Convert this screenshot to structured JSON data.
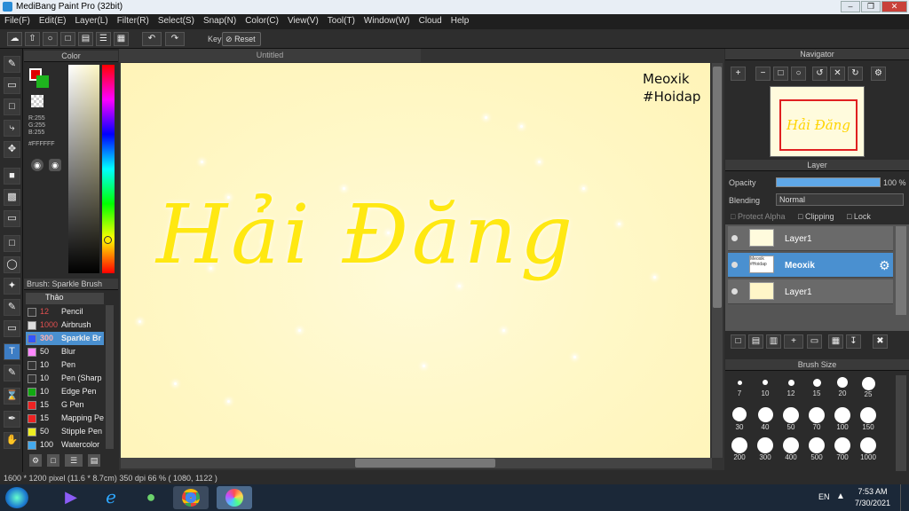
{
  "window": {
    "title": "MediBang Paint Pro (32bit)"
  },
  "menu": [
    "File(F)",
    "Edit(E)",
    "Layer(L)",
    "Filter(R)",
    "Select(S)",
    "Snap(N)",
    "Color(C)",
    "View(V)",
    "Tool(T)",
    "Window(W)",
    "Cloud",
    "Help"
  ],
  "toolbar": {
    "key_label": "Key",
    "reset_label": "Reset"
  },
  "color_panel": {
    "title": "Color",
    "r": "R:255",
    "g": "G:255",
    "b": "B:255",
    "hex": "#FFFFFF",
    "fg_color": "#e00000",
    "bg_color": "#1eb41e"
  },
  "brush_panel": {
    "title": "Brush: Sparkle Brush",
    "group": "Thảo",
    "brushes": [
      {
        "size": "12",
        "name": "Pencil",
        "color": "#333333",
        "size_color": "#e05050"
      },
      {
        "size": "1000",
        "name": "Airbrush",
        "color": "#dddddd",
        "size_color": "#e05050"
      },
      {
        "size": "300",
        "name": "Sparkle Br",
        "color": "#3355ff",
        "size_color": "#ff8080"
      },
      {
        "size": "50",
        "name": "Blur",
        "color": "#ff88ff",
        "size_color": "#eeeeee"
      },
      {
        "size": "10",
        "name": "Pen",
        "color": "#333333",
        "size_color": "#eeeeee"
      },
      {
        "size": "10",
        "name": "Pen (Sharp",
        "color": "#333333",
        "size_color": "#eeeeee"
      },
      {
        "size": "10",
        "name": "Edge Pen",
        "color": "#11aa11",
        "size_color": "#eeeeee"
      },
      {
        "size": "15",
        "name": "G Pen",
        "color": "#ee2222",
        "size_color": "#eeeeee"
      },
      {
        "size": "15",
        "name": "Mapping Pe",
        "color": "#ee2222",
        "size_color": "#eeeeee"
      },
      {
        "size": "50",
        "name": "Stipple Pen",
        "color": "#eeee22",
        "size_color": "#eeeeee"
      },
      {
        "size": "100",
        "name": "Watercolor",
        "color": "#44aaee",
        "size_color": "#eeeeee"
      }
    ]
  },
  "canvas": {
    "tab_title": "Untitled",
    "watermark_line1": "Meoxik",
    "watermark_line2": "#Hoidap",
    "artwork_text": "Hải Đăng",
    "artwork_color": "#ffe812"
  },
  "navigator": {
    "title": "Navigator"
  },
  "layer_panel": {
    "title": "Layer",
    "opacity_label": "Opacity",
    "opacity_value": "100 %",
    "blending_label": "Blending",
    "blending_value": "Normal",
    "protect_alpha": "Protect Alpha",
    "clipping": "Clipping",
    "lock": "Lock",
    "layers": [
      {
        "name": "Layer1",
        "selected": false
      },
      {
        "name": "Meoxik",
        "selected": true,
        "thumb_text": "Meoxik #Hoidap"
      },
      {
        "name": "Layer1",
        "selected": false
      }
    ]
  },
  "brush_size": {
    "title": "Brush Size",
    "sizes": [
      "7",
      "10",
      "12",
      "15",
      "20",
      "25",
      "30",
      "40",
      "50",
      "70",
      "100",
      "150",
      "200",
      "300",
      "400",
      "500",
      "700",
      "1000"
    ]
  },
  "status": {
    "text": "1600 * 1200 pixel   (11.6 * 8.7cm)   350 dpi   66 %   ( 1080, 1122 )"
  },
  "taskbar": {
    "lang": "EN",
    "time": "7:53 AM",
    "date": "7/30/2021"
  }
}
